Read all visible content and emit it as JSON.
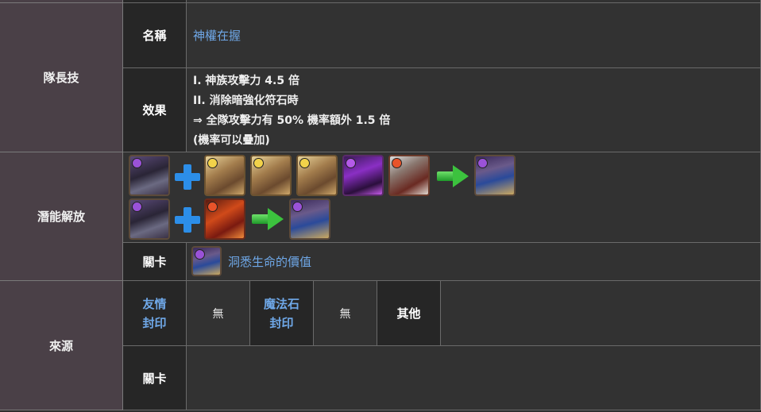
{
  "leader_skill": {
    "section_label": "隊長技",
    "name_label": "名稱",
    "name_value": "神權在握",
    "effect_label": "效果",
    "effect_lines": [
      "I. 神族攻擊力 4.5 倍",
      "II. 消除暗強化符石時",
      "⇒ 全隊攻擊力有 50% 機率額外 1.5 倍",
      "(機率可以疊加)"
    ]
  },
  "potential": {
    "section_label": "潛能解放",
    "recipe_row_1": {
      "base": "dark-armored-knight-card-icon",
      "materials": [
        "light-bearded-sage-card-icon",
        "light-bearded-sage-card-icon",
        "light-bearded-sage-card-icon",
        "dark-purple-demon-card-icon",
        "fire-white-wolf-card-icon"
      ],
      "result": "dark-evolved-knight-card-icon"
    },
    "recipe_row_2": {
      "base": "dark-armored-knight-card-icon",
      "materials": [
        "fire-red-dragon-card-icon"
      ],
      "result": "dark-evolved-knight-card-icon"
    },
    "stage_label": "關卡",
    "stage_icon": "dark-evolved-knight-card-icon",
    "stage_value": "洞悉生命的價值"
  },
  "source": {
    "section_label": "來源",
    "friend_seal_label": [
      "友情",
      "封印"
    ],
    "friend_seal_value": "無",
    "magic_seal_label": [
      "魔法石",
      "封印"
    ],
    "magic_seal_value": "無",
    "other_label": "其他",
    "other_value": "",
    "stage_label": "關卡",
    "stage_value": ""
  },
  "colors": {
    "side_header_bg": "#4a4047",
    "label_bg": "#262626",
    "body_bg": "#323232",
    "link": "#6fa8e8",
    "plus": "#2c8ee8",
    "arrow": "#3cc23e"
  }
}
